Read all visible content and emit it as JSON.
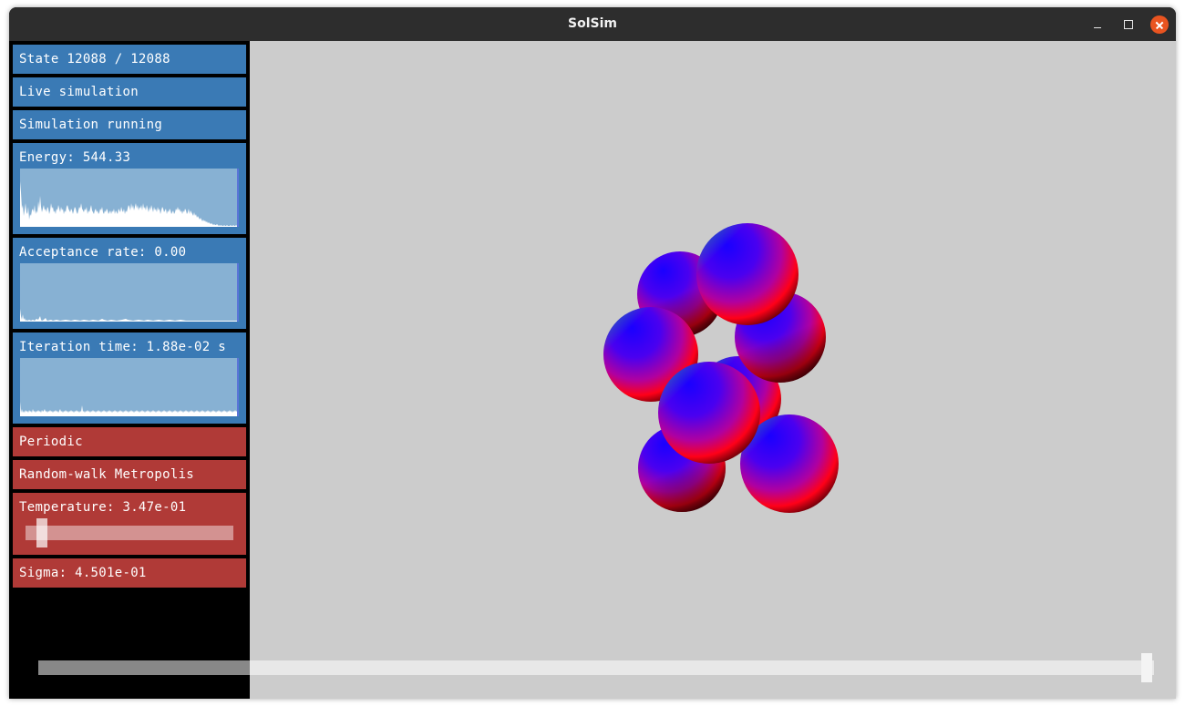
{
  "window": {
    "title": "SolSim",
    "controls": [
      "minimize-icon",
      "maximize-icon",
      "close-icon"
    ]
  },
  "status": {
    "state_label": "State 12088 / 12088",
    "state_current": 12088,
    "state_total": 12088,
    "mode": "Live simulation",
    "run_state": "Simulation running"
  },
  "energy": {
    "label": "Energy: 544.33",
    "value": 544.33
  },
  "acceptance": {
    "label": "Acceptance rate: 0.00",
    "value": 0.0
  },
  "iteration": {
    "label": "Iteration time: 1.88e-02 s"
  },
  "settings": {
    "boundary": "Periodic",
    "algorithm": "Random-walk Metropolis",
    "temperature_label": "Temperature: 3.47e-01",
    "temperature_slider_fraction": 0.06,
    "sigma_label": "Sigma: 4.501e-01"
  },
  "timeline": {
    "position_fraction": 1.0,
    "played_fraction_visible": 0.19
  },
  "colors": {
    "info_panel": "#3a7ab5",
    "control_panel": "#b03a37",
    "histogram_bg": "#87b1d3",
    "viewport_bg": "#cccccc",
    "close_button": "#e95420"
  }
}
